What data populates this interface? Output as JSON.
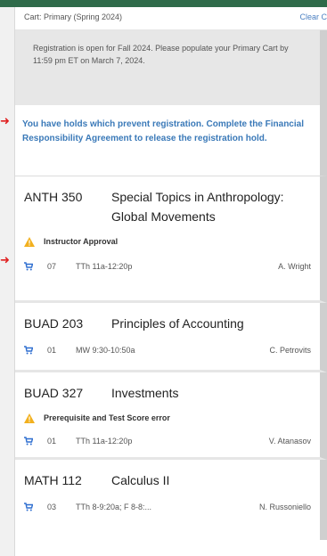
{
  "cart": {
    "title": "Cart: Primary (Spring 2024)",
    "clear_label": "Clear C"
  },
  "notice": "Registration is open for Fall 2024. Please populate your Primary Cart by 11:59 pm ET on March 7, 2024.",
  "holds": "You have holds which prevent registration. Complete the Financial Responsibility Agreement to release the registration hold.",
  "courses": [
    {
      "code": "ANTH 350",
      "name": "Special Topics in Anthropology: Global Movements",
      "requirement": "Instructor Approval",
      "section": "07",
      "time": "TTh 11a-12:20p",
      "instructor": "A. Wright"
    },
    {
      "code": "BUAD 203",
      "name": "Principles of Accounting",
      "requirement": "",
      "section": "01",
      "time": "MW 9:30-10:50a",
      "instructor": "C. Petrovits"
    },
    {
      "code": "BUAD 327",
      "name": "Investments",
      "requirement": "Prerequisite and Test Score error",
      "section": "01",
      "time": "TTh 11a-12:20p",
      "instructor": "V. Atanasov"
    },
    {
      "code": "MATH 112",
      "name": "Calculus II",
      "requirement": "",
      "section": "03",
      "time": "TTh 8-9:20a; F 8-8:...",
      "instructor": "N. Russoniello"
    }
  ],
  "icons": {
    "warning": "warning-triangle-icon",
    "cart": "cart-icon",
    "arrow": "red-arrow-icon"
  },
  "colors": {
    "accent_link": "#3a79b8",
    "warning": "#f2b01e",
    "annotation_arrow": "#e02020",
    "topbar": "#2f6b4a"
  }
}
